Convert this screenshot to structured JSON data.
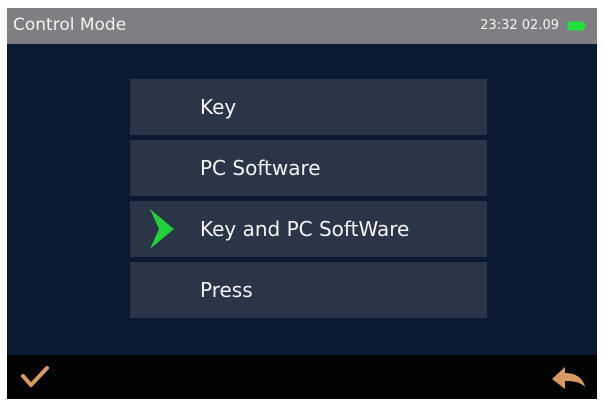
{
  "header": {
    "title": "Control Mode",
    "status_text": "23:32 02.09",
    "battery_icon": "battery-icon"
  },
  "menu": {
    "items": [
      {
        "label": "Key",
        "selected": false
      },
      {
        "label": "PC Software",
        "selected": false
      },
      {
        "label": "Key and PC SoftWare",
        "selected": true
      },
      {
        "label": "Press",
        "selected": false
      }
    ]
  },
  "footer": {
    "confirm_icon": "check-icon",
    "back_icon": "back-arrow-icon"
  },
  "colors": {
    "titlebar": "#7e7e83",
    "background": "#0b1a33",
    "menu_item": "#2b3548",
    "selected_arrow": "#22d13a",
    "confirm": "#d89a62",
    "back": "#d89a62",
    "battery": "#22e03c"
  }
}
